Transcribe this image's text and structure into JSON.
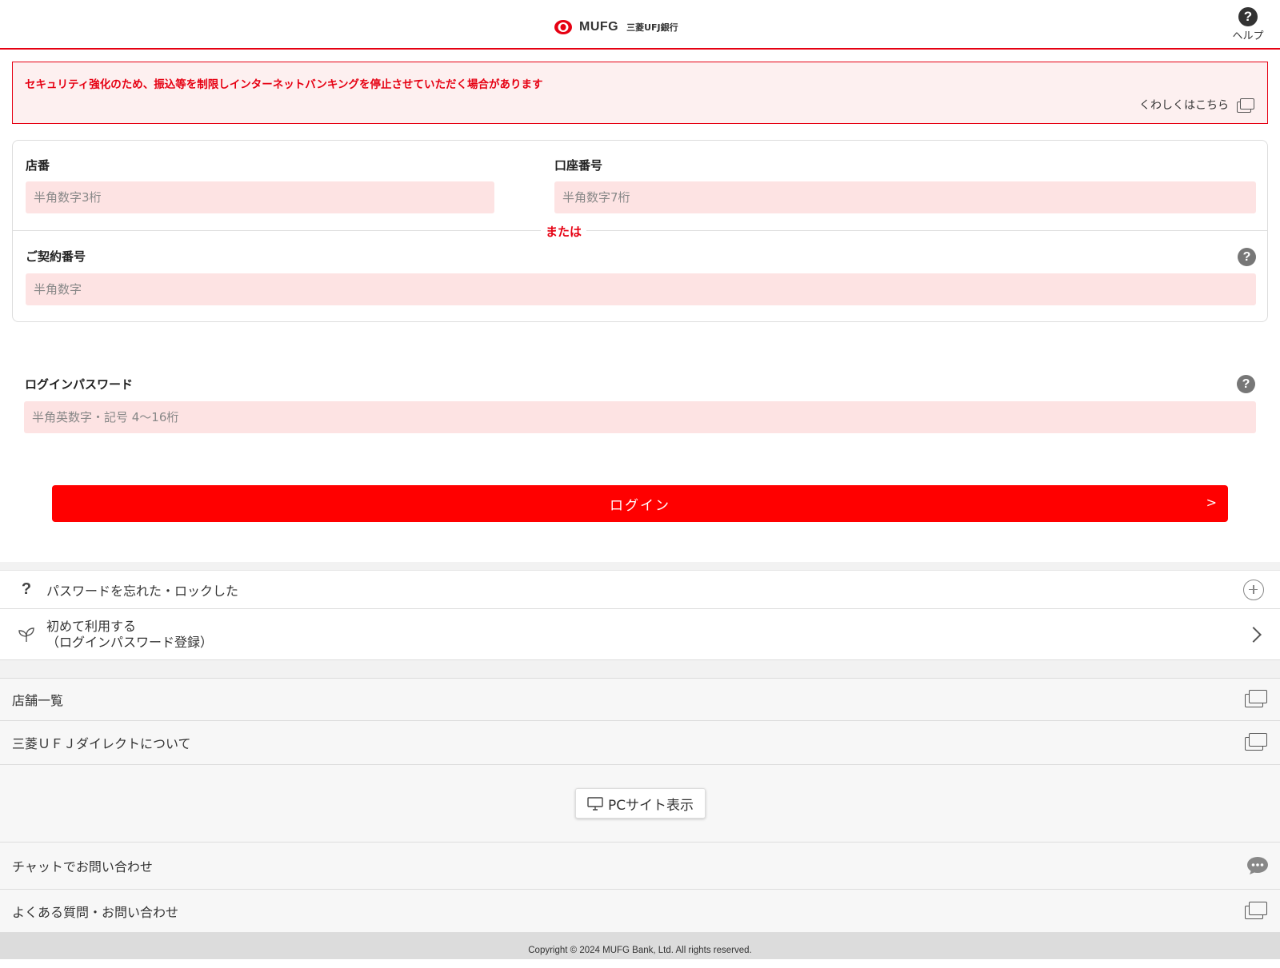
{
  "header": {
    "logo_brand": "MUFG",
    "logo_bank": "三菱UFJ銀行",
    "help_label": "ヘルプ",
    "brand_color": "#e60012"
  },
  "notice": {
    "text": "セキュリティ強化のため、振込等を制限しインターネットバンキングを停止させていただく場合があります",
    "link_label": "くわしくはこちら"
  },
  "account": {
    "branch_label": "店番",
    "branch_placeholder": "半角数字3桁",
    "account_label": "口座番号",
    "account_placeholder": "半角数字7桁",
    "or_label": "または",
    "contract_label": "ご契約番号",
    "contract_placeholder": "半角数字"
  },
  "password": {
    "label": "ログインパスワード",
    "placeholder": "半角英数字・記号 4～16桁"
  },
  "login_button": {
    "label": "ログイン",
    "arrow": ">"
  },
  "links": {
    "forgot": "パスワードを忘れた・ロックした",
    "first_use_line1": "初めて利用する",
    "first_use_line2": "（ログインパスワード登録）",
    "branch_list": "店舗一覧",
    "about_direct": "三菱ＵＦＪダイレクトについて",
    "pc_site": "PCサイト表示",
    "chat": "チャットでお問い合わせ",
    "faq": "よくある質問・お問い合わせ"
  },
  "footer": {
    "copyright": "Copyright © 2024 MUFG Bank, Ltd. All rights reserved."
  }
}
